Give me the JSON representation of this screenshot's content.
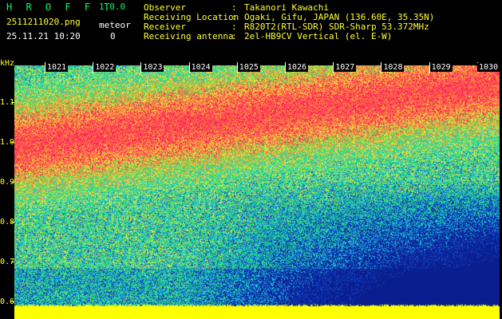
{
  "app": {
    "title": "H R O F F T",
    "version": "1.0.0",
    "filename": "2511211020.png",
    "timestamp": "25.11.21 10:20",
    "meteor_label": "meteor",
    "meteor_count": "0"
  },
  "info": [
    {
      "label": "Observer",
      "colon": ":",
      "value": "Takanori Kawachi"
    },
    {
      "label": "Receiving Location",
      "colon": ":",
      "value": "Ogaki, Gifu, JAPAN (136.60E, 35.35N)"
    },
    {
      "label": "Receiver",
      "colon": ":",
      "value": "R820T2(RTL-SDR) SDR-Sharp 53.372MHz"
    },
    {
      "label": "Receiving antenna",
      "colon": ":",
      "value": "2el-HB9CV Vertical (el. E-W)"
    }
  ],
  "spectrogram": {
    "y_unit": "kHz",
    "y_ticks": [
      "1.1",
      "1.0",
      "0.9",
      "0.8",
      "0.7",
      "0.6"
    ],
    "minute_labels": [
      "1021",
      "1022",
      "1023",
      "1024",
      "1025",
      "1026",
      "1027",
      "1028",
      "1029",
      "1030"
    ],
    "colors": {
      "noise_low": "#0a1f8f",
      "noise_mid": "#18c8d8",
      "noise_green": "#33e066",
      "noise_high": "#ff2a5a",
      "baseline": "#ffff00"
    }
  }
}
